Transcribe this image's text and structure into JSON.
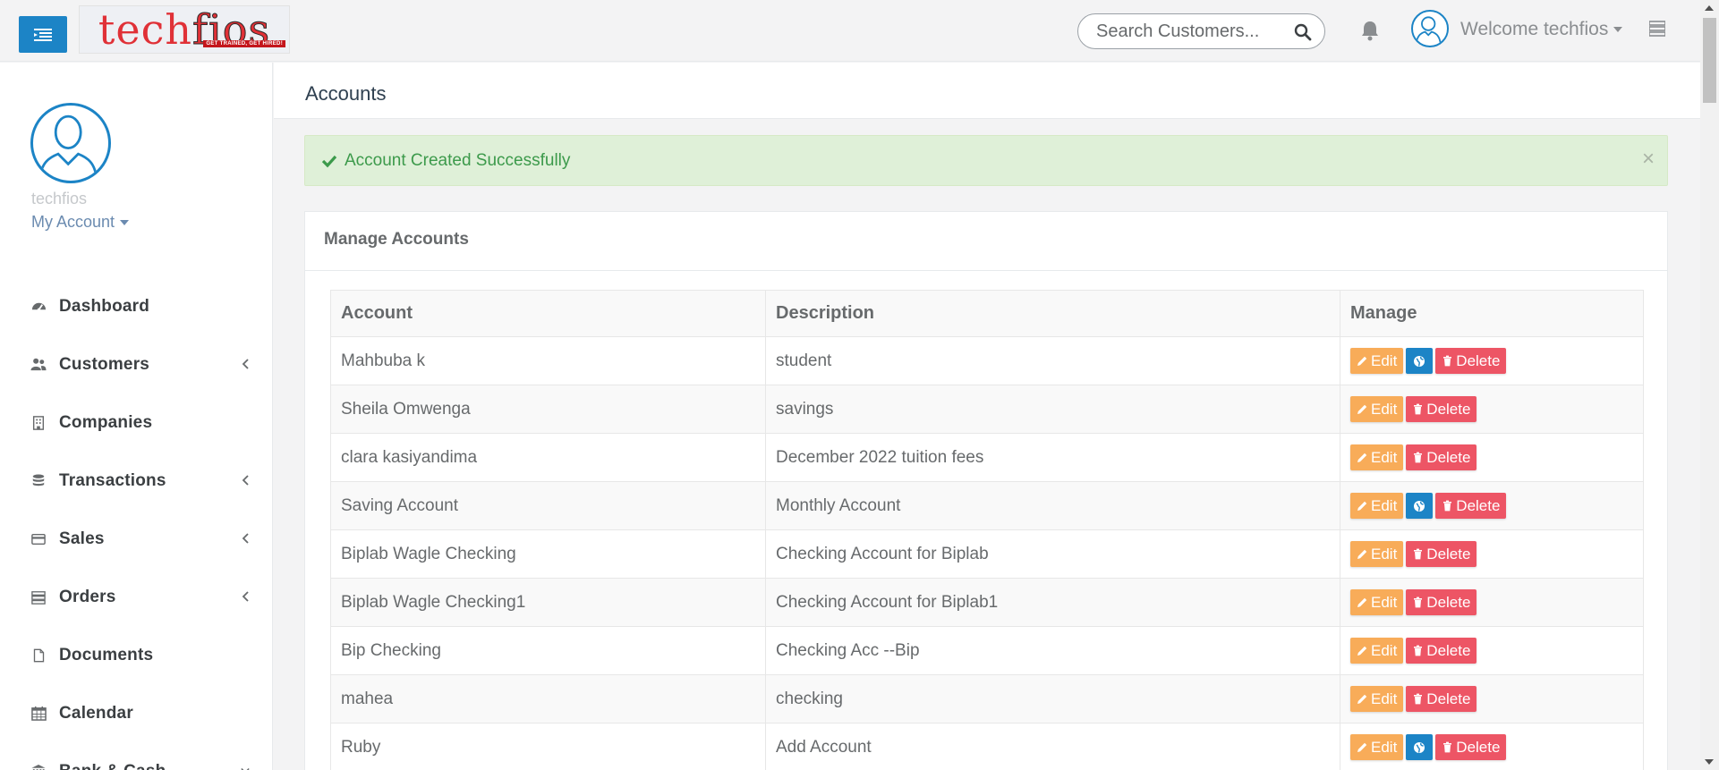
{
  "header": {
    "logo_primary": "tech",
    "logo_secondary": "fios",
    "logo_tagline": "GET TRAINED, GET HIRED!",
    "search_placeholder": "Search Customers...",
    "welcome_text": "Welcome techfios"
  },
  "sidebar": {
    "profile_name": "techfios",
    "my_account_label": "My Account",
    "items": [
      {
        "label": "Dashboard",
        "icon": "dashboard-icon",
        "has_submenu": false
      },
      {
        "label": "Customers",
        "icon": "users-icon",
        "has_submenu": true
      },
      {
        "label": "Companies",
        "icon": "building-icon",
        "has_submenu": false
      },
      {
        "label": "Transactions",
        "icon": "database-icon",
        "has_submenu": true
      },
      {
        "label": "Sales",
        "icon": "credit-card-icon",
        "has_submenu": true
      },
      {
        "label": "Orders",
        "icon": "server-icon",
        "has_submenu": true
      },
      {
        "label": "Documents",
        "icon": "file-icon",
        "has_submenu": false
      },
      {
        "label": "Calendar",
        "icon": "calendar-icon",
        "has_submenu": false
      },
      {
        "label": "Bank & Cash",
        "icon": "bank-icon",
        "has_submenu": true
      }
    ]
  },
  "page": {
    "title": "Accounts"
  },
  "alert": {
    "message": "Account Created Successfully",
    "close_glyph": "×"
  },
  "panel": {
    "title": "Manage Accounts"
  },
  "table": {
    "headers": [
      "Account",
      "Description",
      "Manage"
    ],
    "edit_label": "Edit",
    "delete_label": "Delete",
    "rows": [
      {
        "account": "Mahbuba k",
        "description": "student",
        "has_web": true
      },
      {
        "account": "Sheila Omwenga",
        "description": "savings",
        "has_web": false
      },
      {
        "account": "clara kasiyandima",
        "description": "December 2022 tuition fees",
        "has_web": false
      },
      {
        "account": "Saving Account",
        "description": "Monthly Account",
        "has_web": true
      },
      {
        "account": "Biplab Wagle Checking",
        "description": "Checking Account for Biplab",
        "has_web": false
      },
      {
        "account": "Biplab Wagle Checking1",
        "description": "Checking Account for Biplab1",
        "has_web": false
      },
      {
        "account": "Bip Checking",
        "description": "Checking Acc --Bip",
        "has_web": false
      },
      {
        "account": "mahea",
        "description": "checking",
        "has_web": false
      },
      {
        "account": "Ruby",
        "description": "Add Account",
        "has_web": true
      }
    ]
  },
  "colors": {
    "primary": "#1c84c6",
    "edit": "#f8ac59",
    "delete": "#ed5565",
    "success_bg": "#dff0d8",
    "success_text": "#3c9a4b"
  }
}
